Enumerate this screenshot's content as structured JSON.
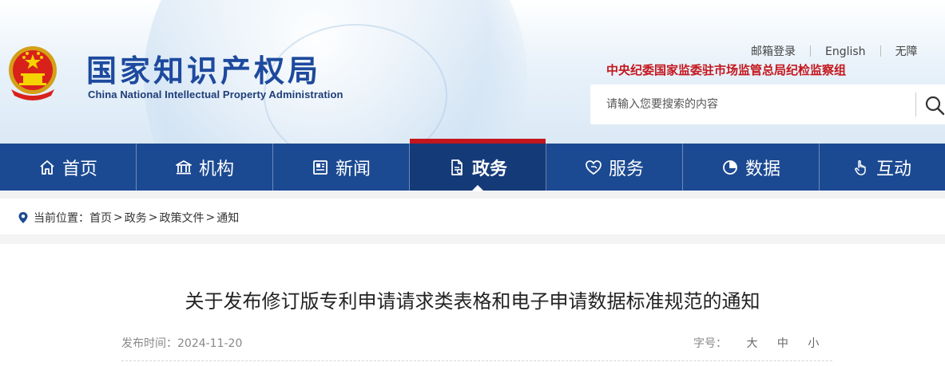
{
  "header": {
    "logo_cn": "国家知识产权局",
    "logo_en": "China National Intellectual Property Administration",
    "top_links": [
      "邮箱登录",
      "English",
      "无障"
    ],
    "discipline_text": "中央纪委国家监委驻市场监管总局纪检监察组",
    "search": {
      "placeholder": "请输入您要搜索的内容",
      "icon": "search-icon"
    },
    "emblem_icon": "national-emblem-icon"
  },
  "nav": {
    "items": [
      {
        "label": "首页",
        "icon": "home-icon"
      },
      {
        "label": "机构",
        "icon": "institution-icon"
      },
      {
        "label": "新闻",
        "icon": "news-icon"
      },
      {
        "label": "政务",
        "icon": "document-icon"
      },
      {
        "label": "服务",
        "icon": "service-icon"
      },
      {
        "label": "数据",
        "icon": "pie-chart-icon"
      },
      {
        "label": "互动",
        "icon": "hand-pointer-icon"
      }
    ],
    "active": "政务"
  },
  "breadcrumb": {
    "prefix": "当前位置：",
    "items": [
      "首页",
      "政务",
      "政策文件",
      "通知"
    ],
    "separator": ">"
  },
  "article": {
    "title": "关于发布修订版专利申请请求类表格和电子申请数据标准规范的通知",
    "date_label": "发布时间：2024-11-20",
    "font_size_label": "字号：",
    "font_sizes": [
      "大",
      "中",
      "小"
    ]
  },
  "colors": {
    "nav_bg": "#1c4a92",
    "nav_active_bg": "#153a78",
    "accent_red": "#c4161c",
    "logo_blue": "#1d4a9e"
  }
}
